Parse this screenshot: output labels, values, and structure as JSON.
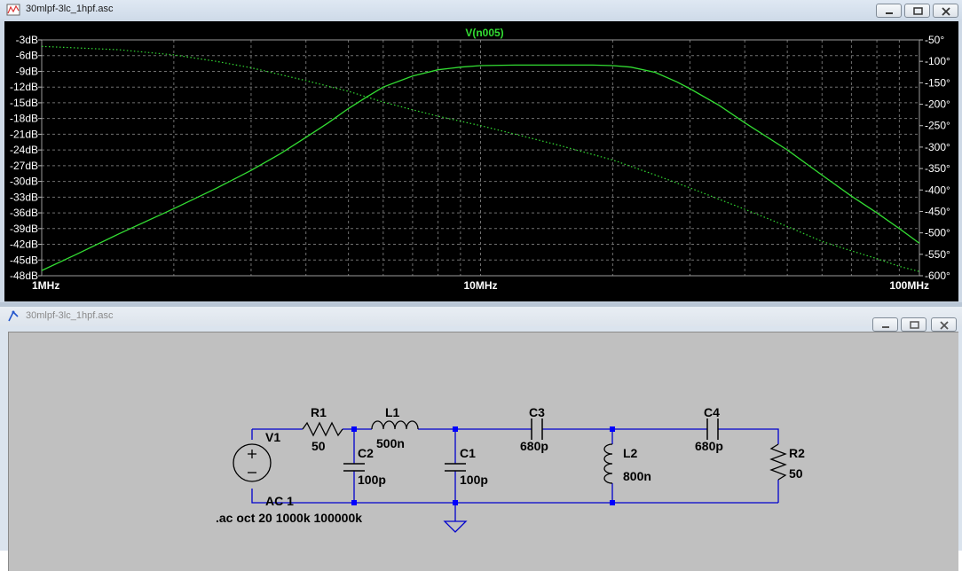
{
  "plot_window": {
    "title": "30mlpf-3lc_1hpf.asc",
    "icon": "waveform-icon"
  },
  "schematic_window": {
    "title": "30mlpf-3lc_1hpf.asc",
    "icon": "schematic-icon"
  },
  "window_buttons": [
    "minimize",
    "restore",
    "close"
  ],
  "chart_data": {
    "type": "line",
    "title": "V(n005)",
    "x_scale": "log",
    "xlim": [
      1000000,
      100000000
    ],
    "x_ticks": [
      "1MHz",
      "10MHz",
      "100MHz"
    ],
    "ylim_left": [
      -48,
      -3
    ],
    "y_ticks_left": [
      "-3dB",
      "-6dB",
      "-9dB",
      "-12dB",
      "-15dB",
      "-18dB",
      "-21dB",
      "-24dB",
      "-27dB",
      "-30dB",
      "-33dB",
      "-36dB",
      "-39dB",
      "-42dB",
      "-45dB",
      "-48dB"
    ],
    "ylim_right": [
      -600,
      -50
    ],
    "y_ticks_right": [
      "-50°",
      "-100°",
      "-150°",
      "-200°",
      "-250°",
      "-300°",
      "-350°",
      "-400°",
      "-450°",
      "-500°",
      "-550°",
      "-600°"
    ],
    "grid": true,
    "colors": {
      "background": "#000000",
      "trace": "#33dd33",
      "grid": "#707070",
      "axis_text": "#ffffff"
    },
    "series": [
      {
        "name": "V(n005)",
        "axis": "magnitude_dB",
        "style": "solid",
        "points": [
          [
            1.0,
            -47.0
          ],
          [
            1.2,
            -43.9
          ],
          [
            1.5,
            -40.0
          ],
          [
            2.0,
            -35.2
          ],
          [
            2.5,
            -31.3
          ],
          [
            3.0,
            -27.9
          ],
          [
            3.5,
            -24.7
          ],
          [
            4.0,
            -21.6
          ],
          [
            4.5,
            -18.8
          ],
          [
            5.0,
            -16.1
          ],
          [
            5.5,
            -13.9
          ],
          [
            6.0,
            -12.0
          ],
          [
            7.0,
            -9.9
          ],
          [
            8.0,
            -8.7
          ],
          [
            9.0,
            -8.2
          ],
          [
            10.0,
            -7.9
          ],
          [
            12.0,
            -7.8
          ],
          [
            15.0,
            -7.8
          ],
          [
            18.0,
            -7.8
          ],
          [
            20.0,
            -7.9
          ],
          [
            22.0,
            -8.2
          ],
          [
            25.0,
            -9.2
          ],
          [
            28.0,
            -11.0
          ],
          [
            30.0,
            -12.3
          ],
          [
            35.0,
            -15.5
          ],
          [
            40.0,
            -18.8
          ],
          [
            50.0,
            -24.0
          ],
          [
            60.0,
            -28.8
          ],
          [
            70.0,
            -32.8
          ],
          [
            80.0,
            -36.0
          ],
          [
            90.0,
            -39.0
          ],
          [
            100.0,
            -41.8
          ]
        ]
      },
      {
        "name": "phase",
        "axis": "phase_deg",
        "style": "dotted",
        "points": [
          [
            1.0,
            -65
          ],
          [
            1.5,
            -73
          ],
          [
            2.0,
            -85
          ],
          [
            2.5,
            -100
          ],
          [
            3.0,
            -115
          ],
          [
            4.0,
            -145
          ],
          [
            5.0,
            -170
          ],
          [
            6.0,
            -195
          ],
          [
            7.0,
            -213
          ],
          [
            8.0,
            -228
          ],
          [
            10.0,
            -250
          ],
          [
            12.0,
            -270
          ],
          [
            15.0,
            -295
          ],
          [
            20.0,
            -330
          ],
          [
            25.0,
            -365
          ],
          [
            30.0,
            -395
          ],
          [
            40.0,
            -445
          ],
          [
            50.0,
            -485
          ],
          [
            60.0,
            -520
          ],
          [
            70.0,
            -542
          ],
          [
            80.0,
            -560
          ],
          [
            90.0,
            -578
          ],
          [
            100.0,
            -590
          ]
        ]
      }
    ]
  },
  "schematic": {
    "components": [
      {
        "id": "V1",
        "label": "V1",
        "value": ""
      },
      {
        "id": "R1",
        "label": "R1",
        "value": "50"
      },
      {
        "id": "L1",
        "label": "L1",
        "value": "500n"
      },
      {
        "id": "C2",
        "label": "C2",
        "value": "100p"
      },
      {
        "id": "C1",
        "label": "C1",
        "value": "100p"
      },
      {
        "id": "C3",
        "label": "C3",
        "value": "680p"
      },
      {
        "id": "L2",
        "label": "L2",
        "value": "800n"
      },
      {
        "id": "C4",
        "label": "C4",
        "value": "680p"
      },
      {
        "id": "R2",
        "label": "R2",
        "value": "50"
      }
    ],
    "source_value": "AC 1",
    "directive": ".ac oct 20 1000k 100000k",
    "colors": {
      "wire": "#0000cc",
      "component": "#000000",
      "junction": "#0000ff",
      "background": "#c0c0c0"
    }
  }
}
